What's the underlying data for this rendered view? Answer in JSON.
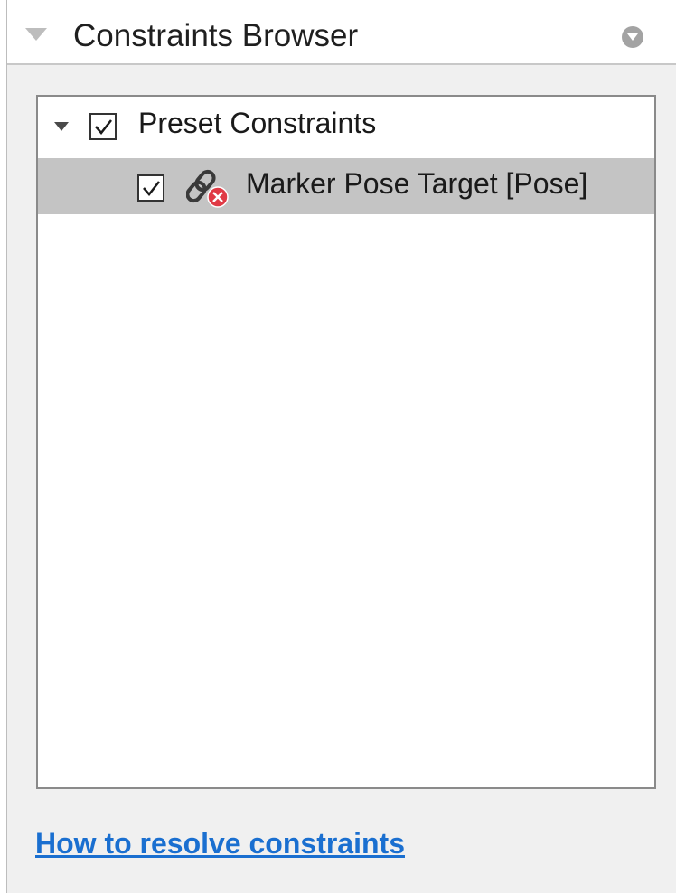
{
  "panel": {
    "title": "Constraints Browser",
    "toggle_icon": "triangle-down-icon",
    "menu_icon": "circle-dropdown-icon"
  },
  "tree": {
    "groups": [
      {
        "label": "Preset Constraints",
        "expanded": true,
        "checked": true,
        "children": [
          {
            "label": "Marker Pose Target [Pose]",
            "checked": true,
            "selected": true,
            "icon": "broken-link-error-icon"
          }
        ]
      }
    ]
  },
  "footer": {
    "help_link": "How to resolve constraints"
  },
  "colors": {
    "panel_bg": "#f0f0f0",
    "selected_row": "#c4c4c4",
    "link": "#1a6fd0",
    "error_badge": "#e03a45"
  }
}
